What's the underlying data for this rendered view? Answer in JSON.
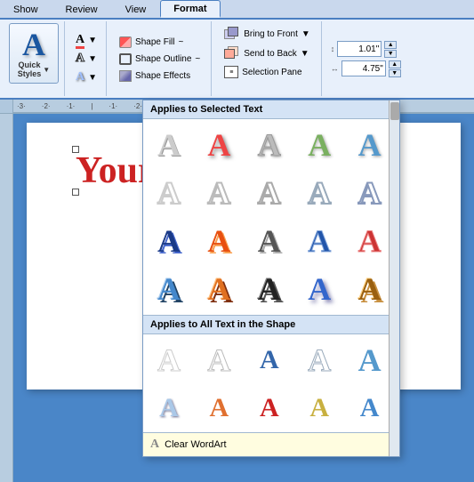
{
  "tabs": [
    {
      "label": "Show",
      "active": false
    },
    {
      "label": "Review",
      "active": false
    },
    {
      "label": "View",
      "active": false
    },
    {
      "label": "Format",
      "active": true
    }
  ],
  "ribbon": {
    "quick_styles_label": "Quick\nStyles",
    "big_a": "A",
    "shape_fill_label": "Shape Fill",
    "shape_outline_label": "Shape Outline",
    "shape_effects_label": "Shape Effects",
    "bring_to_front_label": "Bring to Front",
    "send_to_back_label": "Send to Back",
    "selection_pane_label": "Selection Pane",
    "size_height": "1.01\"",
    "size_width": "4.75\""
  },
  "dropdown": {
    "header1": "Applies to Selected Text",
    "header2": "Applies to All Text in the Shape",
    "clear_label": "Clear WordArt",
    "styles_row1": [
      {
        "color": "#ccc",
        "shadow": false,
        "style": "plain"
      },
      {
        "color": "#e55",
        "shadow": true,
        "style": "colored"
      },
      {
        "color": "#aaa",
        "shadow": true,
        "style": "gray"
      },
      {
        "color": "#8b8",
        "shadow": true,
        "style": "green"
      },
      {
        "color": "#69c",
        "shadow": true,
        "style": "blue"
      }
    ],
    "styles_row2": [
      {
        "color": "#ddd",
        "outline": true
      },
      {
        "color": "#ddd",
        "outline": true
      },
      {
        "color": "#ddd",
        "outline": true
      },
      {
        "color": "#ddd",
        "outline": true
      },
      {
        "color": "#ddd",
        "outline": true
      }
    ],
    "styles_row3": [
      {
        "color": "#1a4a99",
        "style": "dark-blue"
      },
      {
        "color": "#e55",
        "style": "red-orange"
      },
      {
        "color": "#888",
        "style": "gray"
      },
      {
        "color": "#36a",
        "style": "blue-outline"
      },
      {
        "color": "#c44",
        "style": "red-outline"
      }
    ],
    "styles_row4": [
      {
        "color": "#4488cc",
        "style": "blue-3d"
      },
      {
        "color": "#e07020",
        "style": "orange-3d"
      },
      {
        "color": "#222",
        "style": "black-3d"
      },
      {
        "color": "#336acc",
        "style": "blue-flat"
      },
      {
        "color": "#9a6010",
        "style": "gold"
      }
    ]
  },
  "document": {
    "wordart_text": "Your"
  }
}
